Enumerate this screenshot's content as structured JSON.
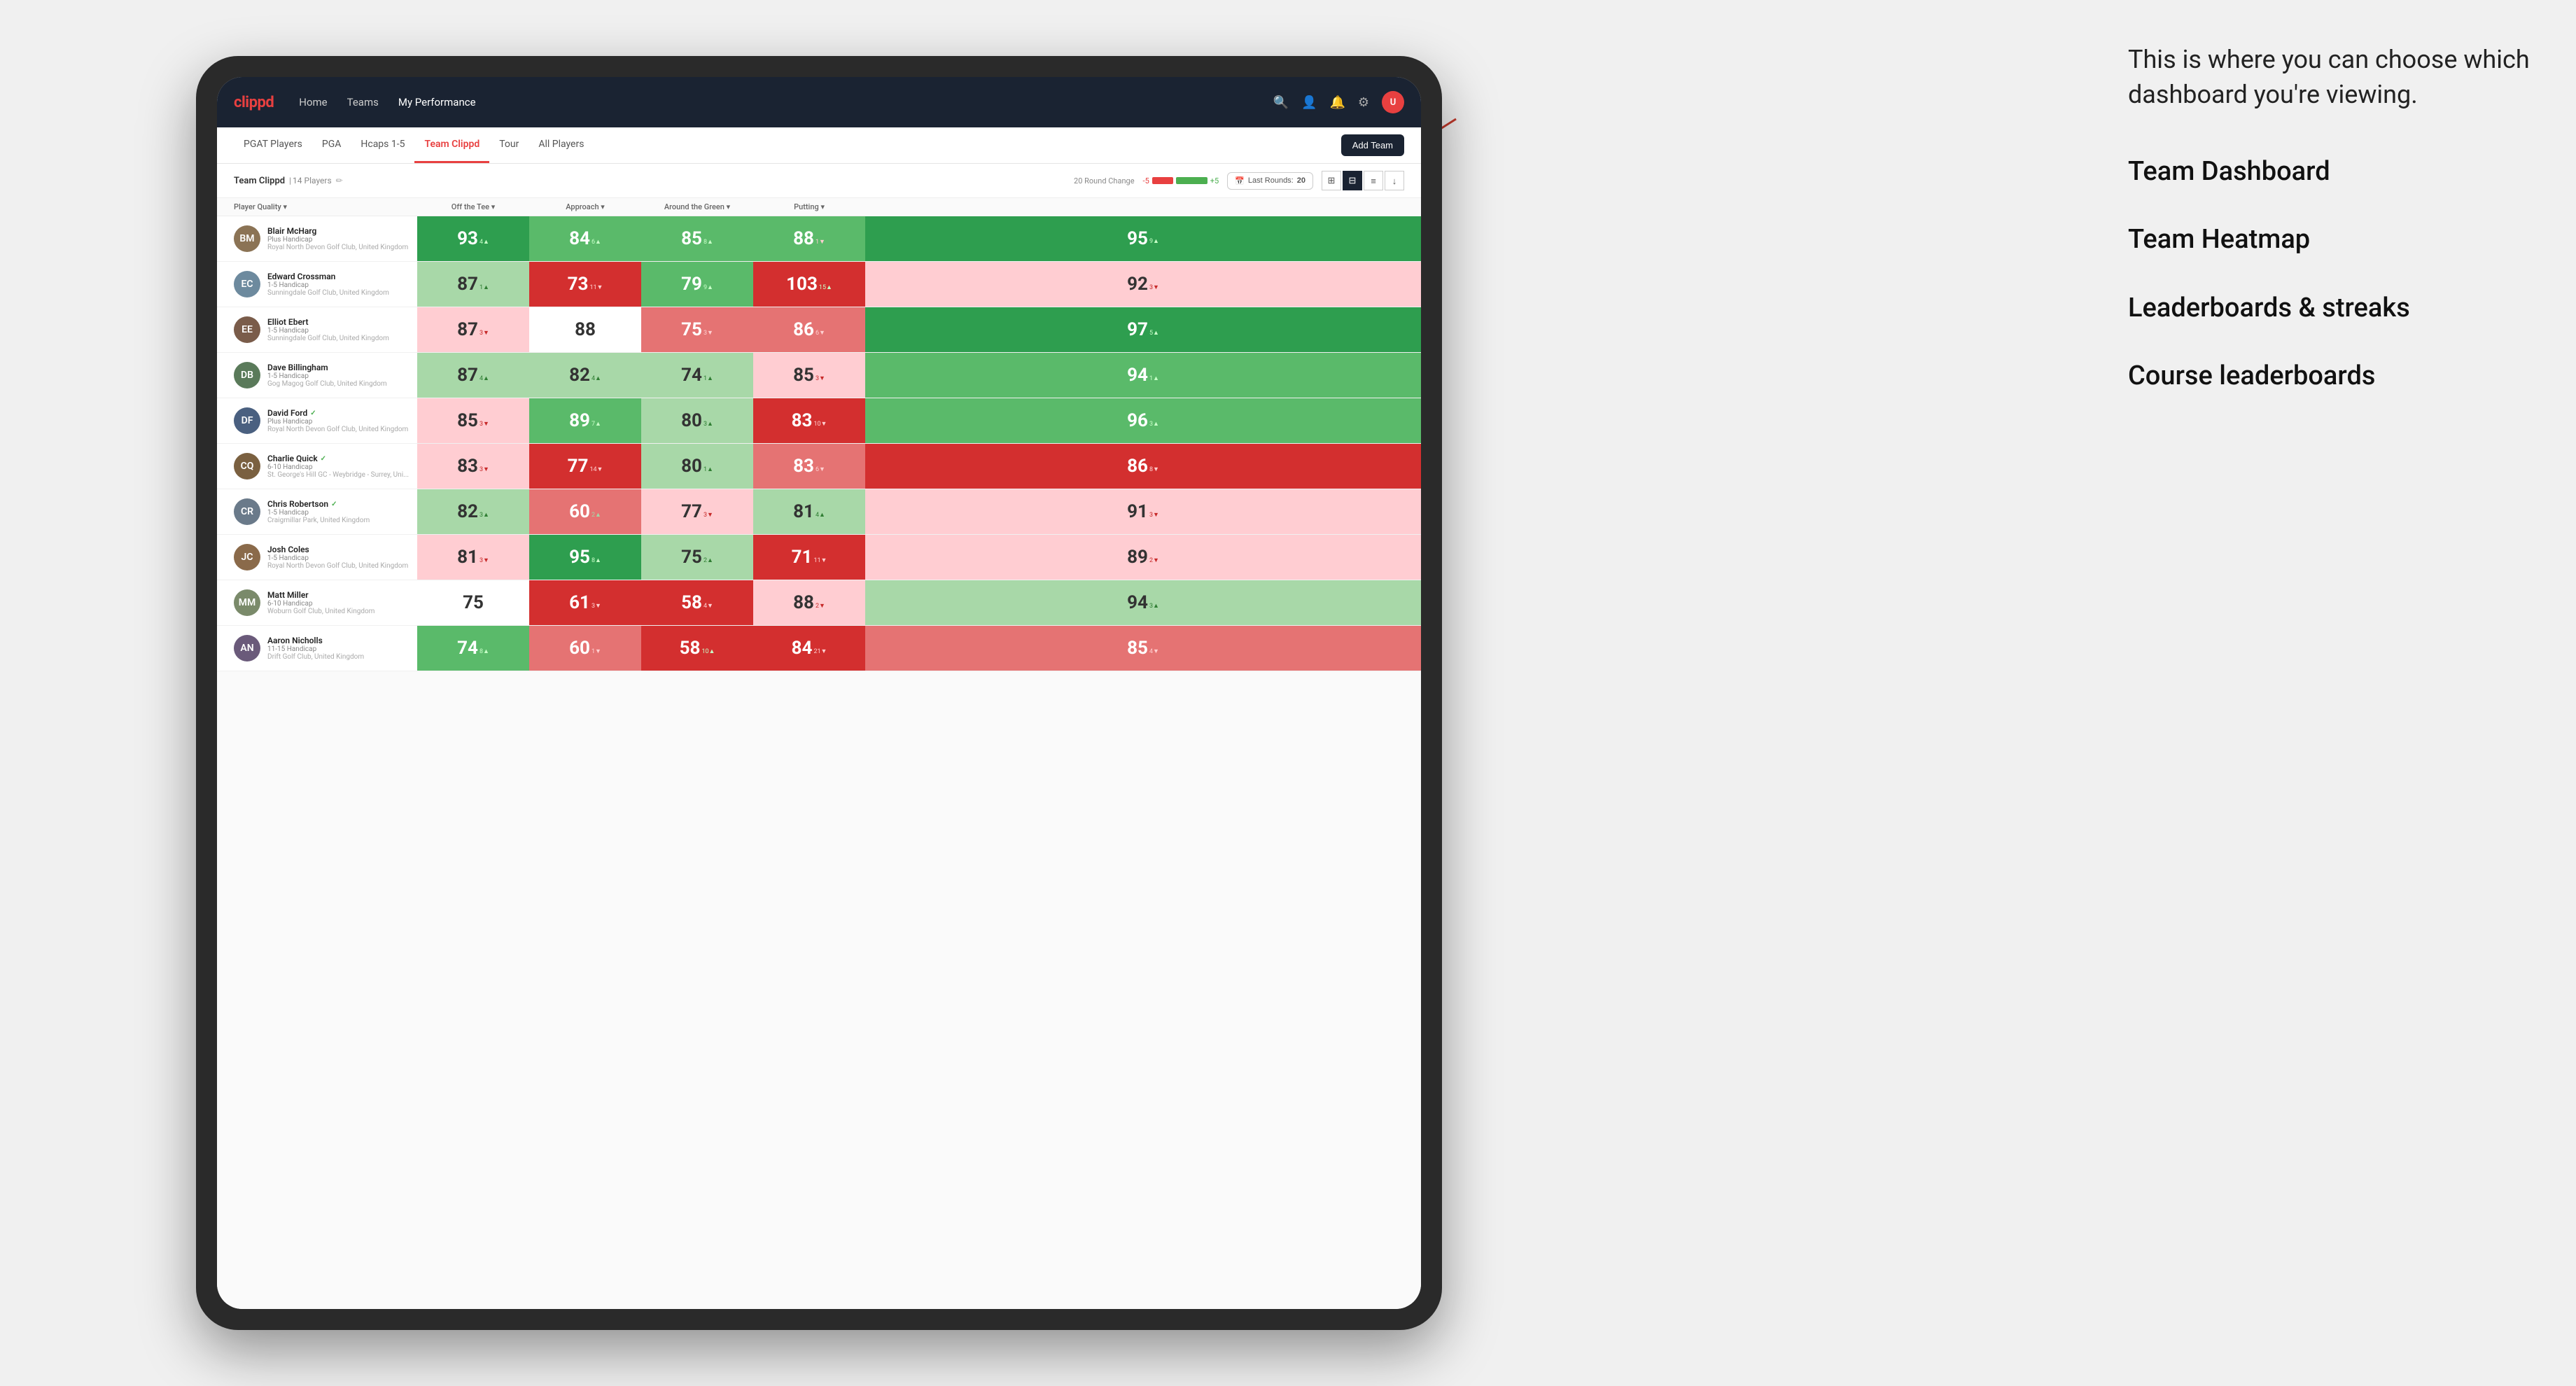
{
  "annotation": {
    "intro": "This is where you can choose which dashboard you're viewing.",
    "options": [
      "Team Dashboard",
      "Team Heatmap",
      "Leaderboards & streaks",
      "Course leaderboards"
    ]
  },
  "navbar": {
    "logo": "clippd",
    "links": [
      "Home",
      "Teams",
      "My Performance"
    ],
    "active_link": "My Performance"
  },
  "subnav": {
    "links": [
      "PGAT Players",
      "PGA",
      "Hcaps 1-5",
      "Team Clippd",
      "Tour",
      "All Players"
    ],
    "active_link": "Team Clippd",
    "add_team_label": "Add Team"
  },
  "team_header": {
    "name": "Team Clippd",
    "count": "14 Players",
    "round_change_label": "20 Round Change",
    "change_neg": "-5",
    "change_pos": "+5",
    "last_rounds_label": "Last Rounds:",
    "last_rounds_value": "20"
  },
  "table": {
    "columns": [
      "Player Quality ▾",
      "Off the Tee ▾",
      "Approach ▾",
      "Around the Green ▾",
      "Putting ▾"
    ],
    "players": [
      {
        "name": "Blair McHarg",
        "hcp": "Plus Handicap",
        "club": "Royal North Devon Golf Club, United Kingdom",
        "avatar_color": "#8B7355",
        "initials": "BM",
        "scores": [
          {
            "val": "93",
            "change": "4",
            "dir": "up",
            "bg": "green-dark"
          },
          {
            "val": "84",
            "change": "6",
            "dir": "up",
            "bg": "green-mid"
          },
          {
            "val": "85",
            "change": "8",
            "dir": "up",
            "bg": "green-mid"
          },
          {
            "val": "88",
            "change": "1",
            "dir": "down",
            "bg": "green-mid"
          },
          {
            "val": "95",
            "change": "9",
            "dir": "up",
            "bg": "green-dark"
          }
        ]
      },
      {
        "name": "Edward Crossman",
        "hcp": "1-5 Handicap",
        "club": "Sunningdale Golf Club, United Kingdom",
        "avatar_color": "#6d8a9e",
        "initials": "EC",
        "scores": [
          {
            "val": "87",
            "change": "1",
            "dir": "up",
            "bg": "green-light"
          },
          {
            "val": "73",
            "change": "11",
            "dir": "down",
            "bg": "red-dark"
          },
          {
            "val": "79",
            "change": "9",
            "dir": "up",
            "bg": "green-mid"
          },
          {
            "val": "103",
            "change": "15",
            "dir": "up",
            "bg": "red-dark"
          },
          {
            "val": "92",
            "change": "3",
            "dir": "down",
            "bg": "red-light"
          }
        ]
      },
      {
        "name": "Elliot Ebert",
        "hcp": "1-5 Handicap",
        "club": "Sunningdale Golf Club, United Kingdom",
        "avatar_color": "#7a5c4a",
        "initials": "EE",
        "scores": [
          {
            "val": "87",
            "change": "3",
            "dir": "down",
            "bg": "red-light"
          },
          {
            "val": "88",
            "change": "",
            "dir": "",
            "bg": "white"
          },
          {
            "val": "75",
            "change": "3",
            "dir": "down",
            "bg": "red-mid"
          },
          {
            "val": "86",
            "change": "6",
            "dir": "down",
            "bg": "red-mid"
          },
          {
            "val": "97",
            "change": "5",
            "dir": "up",
            "bg": "green-dark"
          }
        ]
      },
      {
        "name": "Dave Billingham",
        "hcp": "1-5 Handicap",
        "club": "Gog Magog Golf Club, United Kingdom",
        "avatar_color": "#5a7a5a",
        "initials": "DB",
        "scores": [
          {
            "val": "87",
            "change": "4",
            "dir": "up",
            "bg": "green-light"
          },
          {
            "val": "82",
            "change": "4",
            "dir": "up",
            "bg": "green-light"
          },
          {
            "val": "74",
            "change": "1",
            "dir": "up",
            "bg": "green-light"
          },
          {
            "val": "85",
            "change": "3",
            "dir": "down",
            "bg": "red-light"
          },
          {
            "val": "94",
            "change": "1",
            "dir": "up",
            "bg": "green-mid"
          }
        ]
      },
      {
        "name": "David Ford",
        "hcp": "Plus Handicap",
        "club": "Royal North Devon Golf Club, United Kingdom",
        "avatar_color": "#4a6080",
        "initials": "DF",
        "verified": true,
        "scores": [
          {
            "val": "85",
            "change": "3",
            "dir": "down",
            "bg": "red-light"
          },
          {
            "val": "89",
            "change": "7",
            "dir": "up",
            "bg": "green-mid"
          },
          {
            "val": "80",
            "change": "3",
            "dir": "up",
            "bg": "green-light"
          },
          {
            "val": "83",
            "change": "10",
            "dir": "down",
            "bg": "red-dark"
          },
          {
            "val": "96",
            "change": "3",
            "dir": "up",
            "bg": "green-mid"
          }
        ]
      },
      {
        "name": "Charlie Quick",
        "hcp": "6-10 Handicap",
        "club": "St. George's Hill GC - Weybridge - Surrey, Uni...",
        "avatar_color": "#7a6040",
        "initials": "CQ",
        "verified": true,
        "scores": [
          {
            "val": "83",
            "change": "3",
            "dir": "down",
            "bg": "red-light"
          },
          {
            "val": "77",
            "change": "14",
            "dir": "down",
            "bg": "red-dark"
          },
          {
            "val": "80",
            "change": "1",
            "dir": "up",
            "bg": "green-light"
          },
          {
            "val": "83",
            "change": "6",
            "dir": "down",
            "bg": "red-mid"
          },
          {
            "val": "86",
            "change": "8",
            "dir": "down",
            "bg": "red-dark"
          }
        ]
      },
      {
        "name": "Chris Robertson",
        "hcp": "1-5 Handicap",
        "club": "Craigmillar Park, United Kingdom",
        "avatar_color": "#6a7a8a",
        "initials": "CR",
        "verified": true,
        "scores": [
          {
            "val": "82",
            "change": "3",
            "dir": "up",
            "bg": "green-light"
          },
          {
            "val": "60",
            "change": "2",
            "dir": "up",
            "bg": "red-mid"
          },
          {
            "val": "77",
            "change": "3",
            "dir": "down",
            "bg": "red-light"
          },
          {
            "val": "81",
            "change": "4",
            "dir": "up",
            "bg": "green-light"
          },
          {
            "val": "91",
            "change": "3",
            "dir": "down",
            "bg": "red-light"
          }
        ]
      },
      {
        "name": "Josh Coles",
        "hcp": "1-5 Handicap",
        "club": "Royal North Devon Golf Club, United Kingdom",
        "avatar_color": "#8a6a4a",
        "initials": "JC",
        "scores": [
          {
            "val": "81",
            "change": "3",
            "dir": "down",
            "bg": "red-light"
          },
          {
            "val": "95",
            "change": "8",
            "dir": "up",
            "bg": "green-dark"
          },
          {
            "val": "75",
            "change": "2",
            "dir": "up",
            "bg": "green-light"
          },
          {
            "val": "71",
            "change": "11",
            "dir": "down",
            "bg": "red-dark"
          },
          {
            "val": "89",
            "change": "2",
            "dir": "down",
            "bg": "red-light"
          }
        ]
      },
      {
        "name": "Matt Miller",
        "hcp": "6-10 Handicap",
        "club": "Woburn Golf Club, United Kingdom",
        "avatar_color": "#7a8a6a",
        "initials": "MM",
        "scores": [
          {
            "val": "75",
            "change": "",
            "dir": "",
            "bg": "white"
          },
          {
            "val": "61",
            "change": "3",
            "dir": "down",
            "bg": "red-dark"
          },
          {
            "val": "58",
            "change": "4",
            "dir": "down",
            "bg": "red-dark"
          },
          {
            "val": "88",
            "change": "2",
            "dir": "down",
            "bg": "red-light"
          },
          {
            "val": "94",
            "change": "3",
            "dir": "up",
            "bg": "green-light"
          }
        ]
      },
      {
        "name": "Aaron Nicholls",
        "hcp": "11-15 Handicap",
        "club": "Drift Golf Club, United Kingdom",
        "avatar_color": "#6a5a7a",
        "initials": "AN",
        "scores": [
          {
            "val": "74",
            "change": "8",
            "dir": "up",
            "bg": "green-mid"
          },
          {
            "val": "60",
            "change": "1",
            "dir": "down",
            "bg": "red-mid"
          },
          {
            "val": "58",
            "change": "10",
            "dir": "up",
            "bg": "red-dark"
          },
          {
            "val": "84",
            "change": "21",
            "dir": "down",
            "bg": "red-dark"
          },
          {
            "val": "85",
            "change": "4",
            "dir": "down",
            "bg": "red-mid"
          }
        ]
      }
    ]
  }
}
